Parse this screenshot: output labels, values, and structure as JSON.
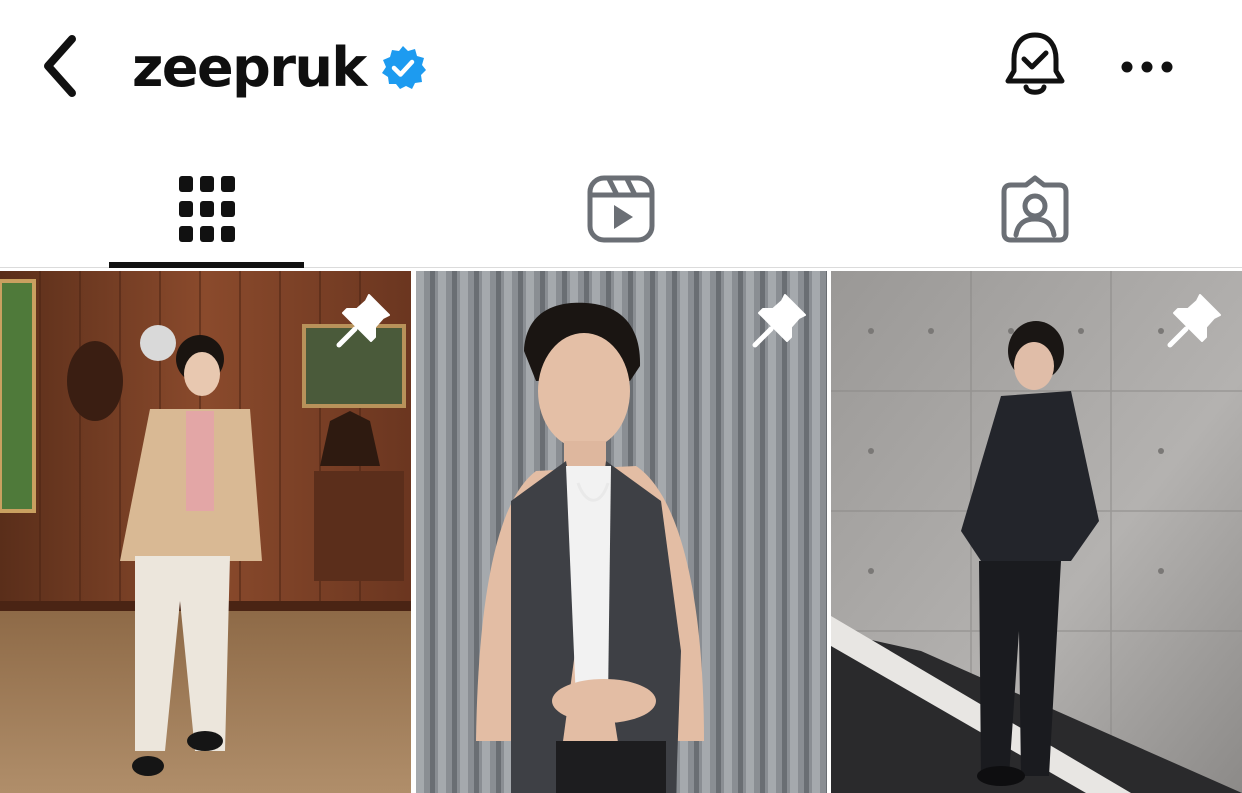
{
  "header": {
    "username": "zeepruk",
    "verified": true,
    "back_icon": "chevron-left-icon",
    "verified_icon": "verified-badge-icon",
    "notification_icon": "bell-check-icon",
    "more_icon": "more-horizontal-icon"
  },
  "tabs": [
    {
      "icon": "grid-icon",
      "active": true
    },
    {
      "icon": "reels-icon",
      "active": false
    },
    {
      "icon": "tagged-icon",
      "active": false
    }
  ],
  "posts": [
    {
      "pinned": true,
      "pin_icon": "pin-icon"
    },
    {
      "pinned": true,
      "pin_icon": "pin-icon"
    },
    {
      "pinned": true,
      "pin_icon": "pin-icon"
    }
  ],
  "colors": {
    "text": "#111111",
    "verified": "#1d9bf0",
    "tab_inactive": "#6b6f75",
    "divider": "#dbdbdb"
  }
}
